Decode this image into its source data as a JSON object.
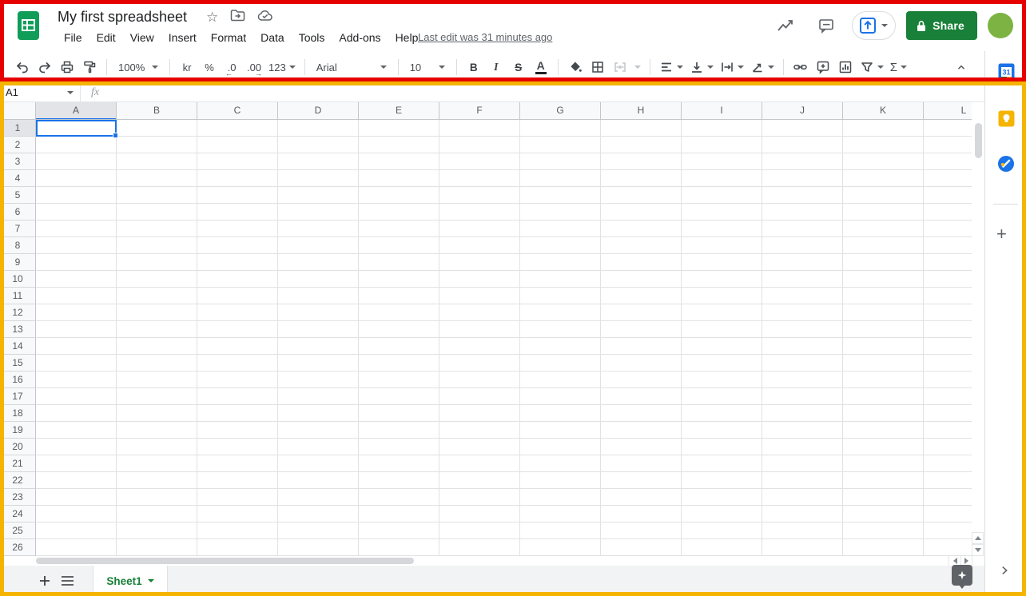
{
  "header": {
    "doc_title": "My first spreadsheet",
    "menu_items": [
      "File",
      "Edit",
      "View",
      "Insert",
      "Format",
      "Data",
      "Tools",
      "Add-ons",
      "Help"
    ],
    "last_edit": "Last edit was 31 minutes ago",
    "share_button": "Share"
  },
  "toolbar": {
    "zoom_value": "100%",
    "currency_label": "kr",
    "percent_label": "%",
    "decrease_decimal_label": ".0",
    "decrease_decimal_arrow": "←",
    "increase_decimal_label": ".00",
    "increase_decimal_arrow": "→",
    "more_formats_label": "123",
    "font_family_value": "Arial",
    "font_size_value": "10",
    "bold_label": "B",
    "italic_label": "I",
    "strikethrough_label": "S",
    "text_color_label": "A",
    "functions_label": "Σ"
  },
  "formula_bar": {
    "name_box_value": "A1",
    "fx_label": "fx",
    "formula_value": ""
  },
  "grid": {
    "columns": [
      "A",
      "B",
      "C",
      "D",
      "E",
      "F",
      "G",
      "H",
      "I",
      "J",
      "K",
      "L"
    ],
    "rows": [
      "1",
      "2",
      "3",
      "4",
      "5",
      "6",
      "7",
      "8",
      "9",
      "10",
      "11",
      "12",
      "13",
      "14",
      "15",
      "16",
      "17",
      "18",
      "19",
      "20",
      "21",
      "22",
      "23",
      "24",
      "25",
      "26"
    ],
    "selected_cell": "A1",
    "selected_column": "A",
    "selected_row": "1"
  },
  "sheet_bar": {
    "active_sheet": "Sheet1"
  },
  "side_panel": {
    "calendar_badge": "31"
  },
  "icons": {
    "star-icon": "☆",
    "move-to-folder-icon": "folder+arrow",
    "cloud-saved-icon": "cloud+check",
    "insights-icon": "trend-line",
    "comment-history-icon": "speech-bubble",
    "present-icon": "box-up-arrow",
    "lock-icon": "padlock",
    "undo-icon": "↶",
    "redo-icon": "↷",
    "print-icon": "printer",
    "paint-format-icon": "paint-roller",
    "fill-color-icon": "paint-bucket",
    "borders-icon": "grid-square",
    "merge-cells-icon": "brackets-arrows",
    "align-left-icon": "three-lines",
    "vertical-align-icon": "arrow-to-baseline",
    "text-wrap-icon": "wrap-arrow",
    "text-rotation-icon": "angled-arrow",
    "insert-link-icon": "chain",
    "insert-comment-icon": "bubble-plus",
    "insert-chart-icon": "bar-chart",
    "filter-icon": "funnel",
    "collapse-toolbar-icon": "chevron-up",
    "add-sheet-icon": "+",
    "all-sheets-icon": "≡",
    "explore-icon": "four-point-star",
    "calendar-icon": "31",
    "keep-icon": "bulb",
    "tasks-icon": "pencil-circle",
    "addon-plus-icon": "+",
    "collapse-panel-icon": "›"
  },
  "colors": {
    "annotation_red": "#e60000",
    "annotation_yellow": "#f4b400",
    "selection_blue": "#1a73e8",
    "share_green": "#188038",
    "avatar_green": "#7cb342",
    "logo_green": "#0f9d58",
    "keep_yellow": "#f5b400",
    "tasks_blue": "#1a73e8",
    "sheet_tab_green": "#188038"
  }
}
